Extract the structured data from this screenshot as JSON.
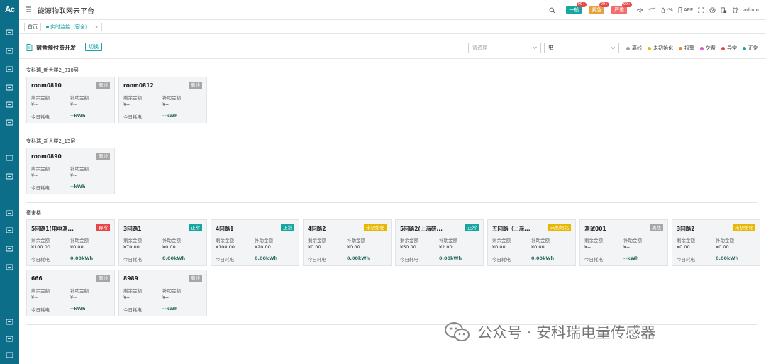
{
  "app": {
    "logo": "Ac",
    "title": "能源物联网云平台",
    "user": "admin"
  },
  "alarms": [
    {
      "label": "一般",
      "count": "99+",
      "color": "#17a5a0"
    },
    {
      "label": "紧急",
      "count": "99+",
      "color": "#e6a23c"
    },
    {
      "label": "严重",
      "count": "99+",
      "color": "#f56c6c"
    }
  ],
  "topbar": {
    "temp": "-℃",
    "humidity": "-%",
    "app_label": "APP"
  },
  "tabs": [
    {
      "label": "首页"
    },
    {
      "label": "实时监控（宿舍）"
    }
  ],
  "page": {
    "title": "宿舍预付费开发",
    "switch_label": "切换",
    "select1_placeholder": "请选择",
    "select2_value": "电"
  },
  "legend": [
    {
      "label": "离线",
      "color": "#a0a0a0"
    },
    {
      "label": "未初始化",
      "color": "#e6b800"
    },
    {
      "label": "报警",
      "color": "#e6862e"
    },
    {
      "label": "欠费",
      "color": "#d957d9"
    },
    {
      "label": "异常",
      "color": "#e64646"
    },
    {
      "label": "正常",
      "color": "#17a5a0"
    }
  ],
  "field_labels": {
    "remain": "剩余金额",
    "subsidy": "补助金额",
    "today": "今日耗电"
  },
  "groups": [
    {
      "title": "安科瑞_新大楼2_810层",
      "cards": [
        {
          "name": "room0810",
          "status": "离线",
          "status_color": "#a6a6a6",
          "remain": "¥--",
          "subsidy": "¥--",
          "today": "--kWh"
        },
        {
          "name": "room0812",
          "status": "离线",
          "status_color": "#a6a6a6",
          "remain": "¥--",
          "subsidy": "¥--",
          "today": "--kWh"
        }
      ]
    },
    {
      "title": "安科瑞_新大楼2_15层",
      "cards": [
        {
          "name": "room0890",
          "status": "离线",
          "status_color": "#a6a6a6",
          "remain": "¥--",
          "subsidy": "¥--",
          "today": "--kWh"
        }
      ]
    },
    {
      "title": "宿舍楼",
      "cards": [
        {
          "name": "5回路1(用电测...",
          "status": "异常",
          "status_color": "#e64646",
          "remain": "¥100.00",
          "subsidy": "¥0.00",
          "today": "0.00kWh"
        },
        {
          "name": "3回路1",
          "status": "正常",
          "status_color": "#17a5a0",
          "remain": "¥70.00",
          "subsidy": "¥0.00",
          "today": "0.00kWh"
        },
        {
          "name": "4回路1",
          "status": "正常",
          "status_color": "#17a5a0",
          "remain": "¥100.00",
          "subsidy": "¥20.00",
          "today": "0.00kWh"
        },
        {
          "name": "4回路2",
          "status": "未初始化",
          "status_color": "#e6b800",
          "remain": "¥0.00",
          "subsidy": "¥0.00",
          "today": "0.00kWh"
        },
        {
          "name": "5回路2(上海研...",
          "status": "正常",
          "status_color": "#17a5a0",
          "remain": "¥50.00",
          "subsidy": "¥2.00",
          "today": "0.00kWh"
        },
        {
          "name": "五回路（上海...",
          "status": "未初始化",
          "status_color": "#e6b800",
          "remain": "¥0.00",
          "subsidy": "¥0.00",
          "today": "0.00kWh"
        },
        {
          "name": "测试001",
          "status": "离线",
          "status_color": "#a6a6a6",
          "remain": "¥--",
          "subsidy": "¥--",
          "today": "--kWh"
        },
        {
          "name": "3回路2",
          "status": "未初始化",
          "status_color": "#e6b800",
          "remain": "¥0.00",
          "subsidy": "¥0.00",
          "today": "0.00kWh"
        },
        {
          "name": "666",
          "status": "离线",
          "status_color": "#a6a6a6",
          "remain": "¥--",
          "subsidy": "¥--",
          "today": "--kWh"
        },
        {
          "name": "8989",
          "status": "离线",
          "status_color": "#a6a6a6",
          "remain": "¥--",
          "subsidy": "¥--",
          "today": "--kWh"
        }
      ]
    }
  ],
  "watermark": "公众号 · 安科瑞电量传感器",
  "sidebar_icons": [
    "monitor-icon",
    "dashboard-icon",
    "display-icon",
    "users-icon",
    "building-icon",
    "document-icon",
    "location-icon",
    "report-icon",
    "settings-icon",
    "thermometer-icon",
    "chart-board-icon",
    "screen-icon",
    "battery-icon",
    "trend-icon",
    "bar-chart-icon"
  ]
}
